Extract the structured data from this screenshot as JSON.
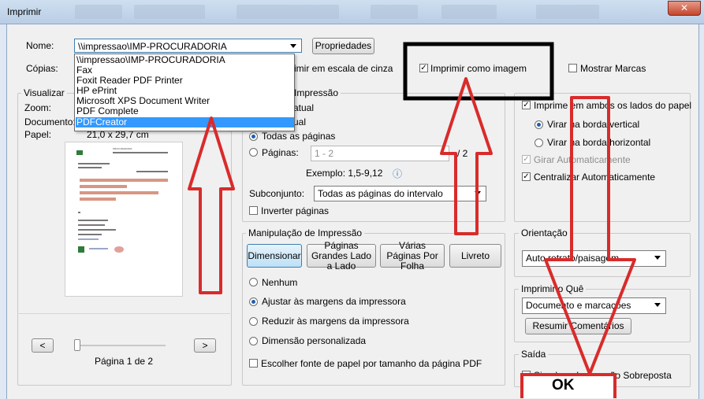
{
  "window": {
    "title": "Imprimir",
    "close_glyph": "✕"
  },
  "printer": {
    "name_label": "Nome:",
    "selected": "\\\\impressao\\IMP-PROCURADORIA",
    "properties_label": "Propriedades",
    "copies_label": "Cópias:",
    "options": [
      "\\\\impressao\\IMP-PROCURADORIA",
      "Fax",
      "Foxit Reader PDF Printer",
      "HP ePrint",
      "Microsoft XPS Document Writer",
      "PDF Complete",
      "PDFCreator"
    ],
    "highlighted_index": 6
  },
  "top_options": {
    "grayscale_label": "imir em escala de cinza",
    "print_as_image_label": "Imprimir como imagem",
    "print_as_image_checked": true,
    "show_marks_label": "Mostrar Marcas",
    "show_marks_checked": false
  },
  "preview_panel": {
    "title": "Visualizar",
    "zoom_label": "Zoom:",
    "document_label": "Documento:",
    "paper_label": "Papel:",
    "paper_value": "21,0 x 29,7 cm",
    "prev_glyph": "<",
    "next_glyph": ">",
    "page_indicator": "Página 1 de 2"
  },
  "range_group": {
    "title": "e Impressão",
    "partial_current": "atual",
    "partial_view": "ual",
    "all_pages": "Todas as páginas",
    "pages_label": "Páginas:",
    "pages_value": "1 - 2",
    "pages_total": "/ 2",
    "example": "Exemplo: 1,5-9,12",
    "info_glyph": "ⓘ",
    "subset_label": "Subconjunto:",
    "subset_value": "Todas as páginas do intervalo",
    "reverse_label": "Inverter páginas"
  },
  "handling_group": {
    "title": "Manipulação de Impressão",
    "buttons": [
      "Dimensionar",
      "Páginas Grandes Lado a Lado",
      "Várias Páginas Por Folha",
      "Livreto"
    ],
    "options": [
      "Nenhum",
      "Ajustar às margens da impressora",
      "Reduzir às margens da impressora",
      "Dimensão personalizada"
    ],
    "selected_option": 1,
    "paper_source_label": "Escolher fonte de papel por tamanho da página PDF"
  },
  "duplex_group": {
    "duplex_label": "Imprime em ambos os lados do papel",
    "flip_long": "Virar na borda vertical",
    "flip_short": "Virar na borda horizontal",
    "auto_rotate": "Girar Automaticamente",
    "auto_center": "Centralizar Automaticamente"
  },
  "orientation_group": {
    "title": "Orientação",
    "value": "Auto retrato/paisagem"
  },
  "what_group": {
    "title": "Imprimir o Quê",
    "value": "Documento e marcações",
    "summarize_label": "Resumir Comentários"
  },
  "output_group": {
    "title": "Saída",
    "overprint_label": "Simular a Impressão Sobreposta"
  },
  "annotation": {
    "ok_text": "OK",
    "annotation_color": "#d92b2b",
    "highlight_box_color": "#000000"
  },
  "preview_doc": {
    "header_text": "PROCURADORIA"
  }
}
